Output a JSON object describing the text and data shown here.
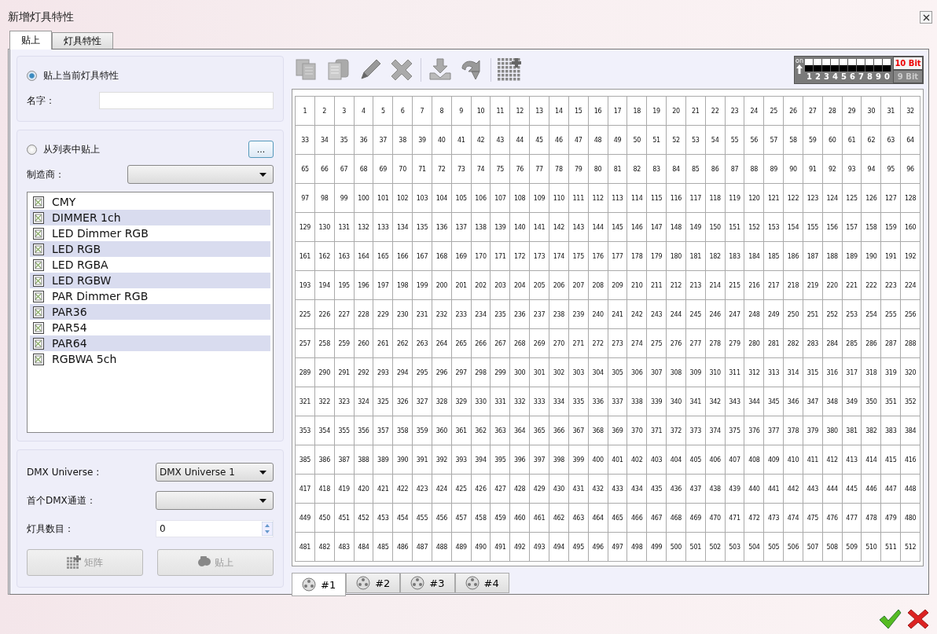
{
  "window": {
    "title": "新增灯具特性"
  },
  "tabs": [
    {
      "label": "贴上",
      "selected": true
    },
    {
      "label": "灯具特性",
      "selected": false
    }
  ],
  "paste_current": {
    "label": "贴上当前灯具特性",
    "selected": true
  },
  "name_field": {
    "label": "名字："
  },
  "paste_from_list": {
    "label": "从列表中贴上",
    "selected": false,
    "browse_button": "..."
  },
  "manufacturer": {
    "label": "制造商："
  },
  "fixtures": [
    "CMY",
    "DIMMER 1ch",
    "LED Dimmer RGB",
    "LED RGB",
    "LED RGBA",
    "LED RGBW",
    "PAR Dimmer RGB",
    "PAR36",
    "PAR54",
    "PAR64",
    "RGBWA 5ch"
  ],
  "dmx_universe": {
    "label": "DMX Universe :",
    "value": "DMX Universe 1"
  },
  "first_channel": {
    "label": "首个DMX通道："
  },
  "fixture_count": {
    "label": "灯具数目：",
    "value": "0"
  },
  "buttons": [
    {
      "kind": "matrix",
      "label": "矩阵",
      "disabled": true
    },
    {
      "kind": "paste",
      "label": "贴上",
      "disabled": true
    }
  ],
  "dip_switch": {
    "on_label": "on",
    "switches": [
      {
        "label": "1",
        "on": false
      },
      {
        "label": "2",
        "on": false
      },
      {
        "label": "3",
        "on": false
      },
      {
        "label": "4",
        "on": false
      },
      {
        "label": "5",
        "on": false
      },
      {
        "label": "6",
        "on": false
      },
      {
        "label": "7",
        "on": false
      },
      {
        "label": "8",
        "on": false
      },
      {
        "label": "9",
        "on": false
      },
      {
        "label": "0",
        "on": false
      }
    ]
  },
  "bit_modes": [
    {
      "label": "10 Bit",
      "selected": true
    },
    {
      "label": "9 Bit",
      "selected": false
    }
  ],
  "channel_grid": {
    "rows": [
      [
        "1",
        "2",
        "3",
        "4",
        "5",
        "6",
        "7",
        "8",
        "9",
        "10",
        "11",
        "12",
        "13",
        "14",
        "15",
        "16",
        "17",
        "18",
        "19",
        "20",
        "21",
        "22",
        "23",
        "24",
        "25",
        "26",
        "27",
        "28",
        "29",
        "30",
        "31",
        "32"
      ],
      [
        "33",
        "34",
        "35",
        "36",
        "37",
        "38",
        "39",
        "40",
        "41",
        "42",
        "43",
        "44",
        "45",
        "46",
        "47",
        "48",
        "49",
        "50",
        "51",
        "52",
        "53",
        "54",
        "55",
        "56",
        "57",
        "58",
        "59",
        "60",
        "61",
        "62",
        "63",
        "64"
      ],
      [
        "65",
        "66",
        "67",
        "68",
        "69",
        "70",
        "71",
        "72",
        "73",
        "74",
        "75",
        "76",
        "77",
        "78",
        "79",
        "80",
        "81",
        "82",
        "83",
        "84",
        "85",
        "86",
        "87",
        "88",
        "89",
        "90",
        "91",
        "92",
        "93",
        "94",
        "95",
        "96"
      ],
      [
        "97",
        "98",
        "99",
        "100",
        "101",
        "102",
        "103",
        "104",
        "105",
        "106",
        "107",
        "108",
        "109",
        "110",
        "111",
        "112",
        "113",
        "114",
        "115",
        "116",
        "117",
        "118",
        "119",
        "120",
        "121",
        "122",
        "123",
        "124",
        "125",
        "126",
        "127",
        "128"
      ],
      [
        "129",
        "130",
        "131",
        "132",
        "133",
        "134",
        "135",
        "136",
        "137",
        "138",
        "139",
        "140",
        "141",
        "142",
        "143",
        "144",
        "145",
        "146",
        "147",
        "148",
        "149",
        "150",
        "151",
        "152",
        "153",
        "154",
        "155",
        "156",
        "157",
        "158",
        "159",
        "160"
      ],
      [
        "161",
        "162",
        "163",
        "164",
        "165",
        "166",
        "167",
        "168",
        "169",
        "170",
        "171",
        "172",
        "173",
        "174",
        "175",
        "176",
        "177",
        "178",
        "179",
        "180",
        "181",
        "182",
        "183",
        "184",
        "185",
        "186",
        "187",
        "188",
        "189",
        "190",
        "191",
        "192"
      ],
      [
        "193",
        "194",
        "195",
        "196",
        "197",
        "198",
        "199",
        "200",
        "201",
        "202",
        "203",
        "204",
        "205",
        "206",
        "207",
        "208",
        "209",
        "210",
        "211",
        "212",
        "213",
        "214",
        "215",
        "216",
        "217",
        "218",
        "219",
        "220",
        "221",
        "222",
        "223",
        "224"
      ],
      [
        "225",
        "226",
        "227",
        "228",
        "229",
        "230",
        "231",
        "232",
        "233",
        "234",
        "235",
        "236",
        "237",
        "238",
        "239",
        "240",
        "241",
        "242",
        "243",
        "244",
        "245",
        "246",
        "247",
        "248",
        "249",
        "250",
        "251",
        "252",
        "253",
        "254",
        "255",
        "256"
      ],
      [
        "257",
        "258",
        "259",
        "260",
        "261",
        "262",
        "263",
        "264",
        "265",
        "266",
        "267",
        "268",
        "269",
        "270",
        "271",
        "272",
        "273",
        "274",
        "275",
        "276",
        "277",
        "278",
        "279",
        "280",
        "281",
        "282",
        "283",
        "284",
        "285",
        "286",
        "287",
        "288"
      ],
      [
        "289",
        "290",
        "291",
        "292",
        "293",
        "294",
        "295",
        "296",
        "297",
        "298",
        "299",
        "300",
        "301",
        "302",
        "303",
        "304",
        "305",
        "306",
        "307",
        "308",
        "309",
        "310",
        "311",
        "312",
        "313",
        "314",
        "315",
        "316",
        "317",
        "318",
        "319",
        "320"
      ],
      [
        "321",
        "322",
        "323",
        "324",
        "325",
        "326",
        "327",
        "328",
        "329",
        "330",
        "331",
        "332",
        "333",
        "334",
        "335",
        "336",
        "337",
        "338",
        "339",
        "340",
        "341",
        "342",
        "343",
        "344",
        "345",
        "346",
        "347",
        "348",
        "349",
        "350",
        "351",
        "352"
      ],
      [
        "353",
        "354",
        "355",
        "356",
        "357",
        "358",
        "359",
        "360",
        "361",
        "362",
        "363",
        "364",
        "365",
        "366",
        "367",
        "368",
        "369",
        "370",
        "371",
        "372",
        "373",
        "374",
        "375",
        "376",
        "377",
        "378",
        "379",
        "380",
        "381",
        "382",
        "383",
        "384"
      ],
      [
        "385",
        "386",
        "387",
        "388",
        "389",
        "390",
        "391",
        "392",
        "393",
        "394",
        "395",
        "396",
        "397",
        "398",
        "399",
        "400",
        "401",
        "402",
        "403",
        "404",
        "405",
        "406",
        "407",
        "408",
        "409",
        "410",
        "411",
        "412",
        "413",
        "414",
        "415",
        "416"
      ],
      [
        "417",
        "418",
        "419",
        "420",
        "421",
        "422",
        "423",
        "424",
        "425",
        "426",
        "427",
        "428",
        "429",
        "430",
        "431",
        "432",
        "433",
        "434",
        "435",
        "436",
        "437",
        "438",
        "439",
        "440",
        "441",
        "442",
        "443",
        "444",
        "445",
        "446",
        "447",
        "448"
      ],
      [
        "449",
        "450",
        "451",
        "452",
        "453",
        "454",
        "455",
        "456",
        "457",
        "458",
        "459",
        "460",
        "461",
        "462",
        "463",
        "464",
        "465",
        "466",
        "467",
        "468",
        "469",
        "470",
        "471",
        "472",
        "473",
        "474",
        "475",
        "476",
        "477",
        "478",
        "479",
        "480"
      ],
      [
        "481",
        "482",
        "483",
        "484",
        "485",
        "486",
        "487",
        "488",
        "489",
        "490",
        "491",
        "492",
        "493",
        "494",
        "495",
        "496",
        "497",
        "498",
        "499",
        "500",
        "501",
        "502",
        "503",
        "504",
        "505",
        "506",
        "507",
        "508",
        "509",
        "510",
        "511",
        "512"
      ]
    ]
  },
  "universe_tabs": [
    {
      "label": "#1",
      "selected": true
    },
    {
      "label": "#2",
      "selected": false
    },
    {
      "label": "#3",
      "selected": false
    },
    {
      "label": "#4",
      "selected": false
    }
  ]
}
